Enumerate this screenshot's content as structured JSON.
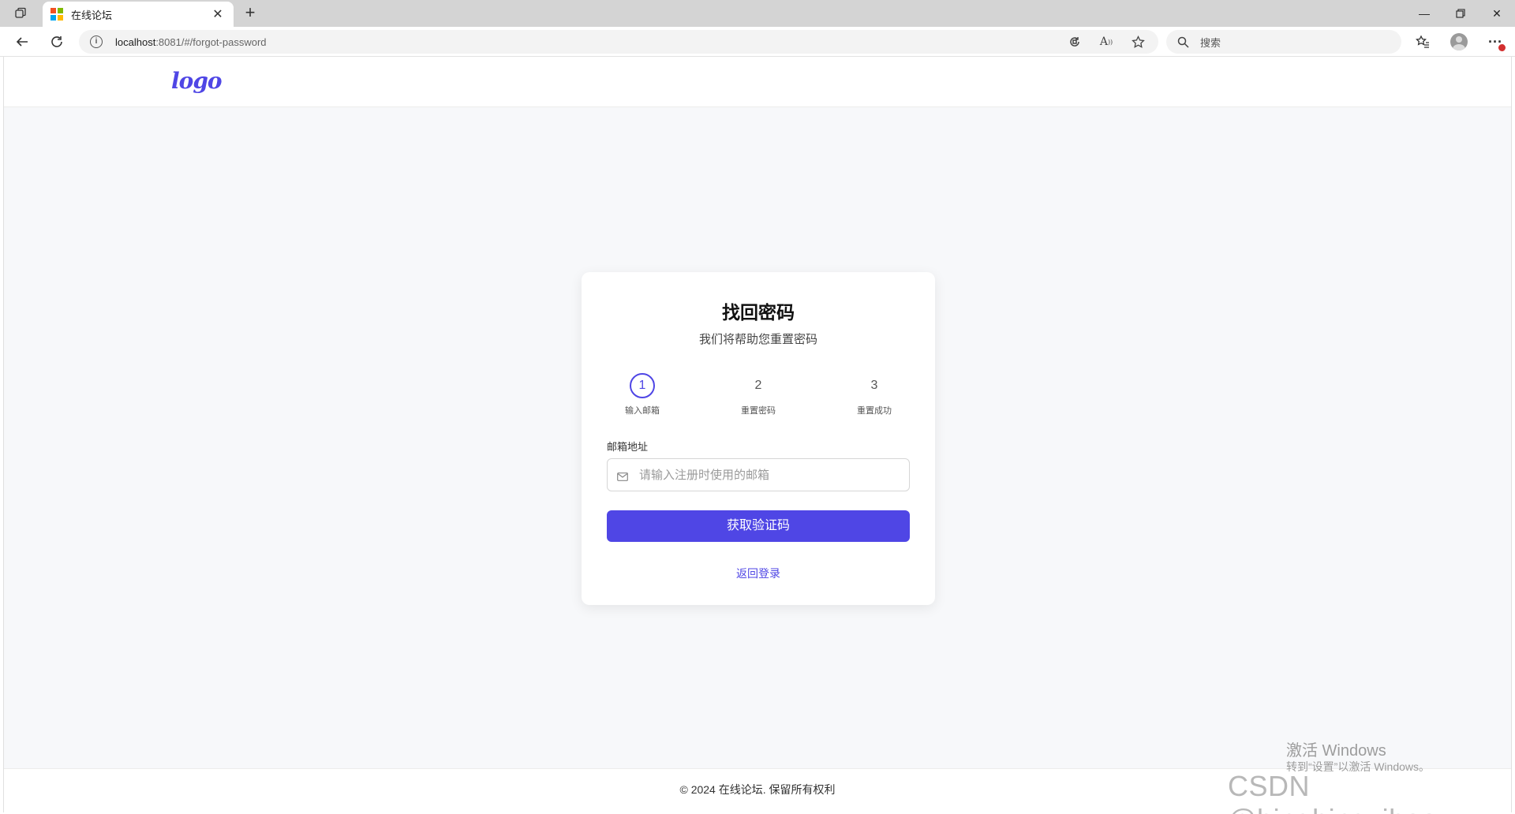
{
  "browser": {
    "tab": {
      "title": "在线论坛"
    },
    "address": {
      "host": "localhost",
      "rest": ":8081/#/forgot-password"
    },
    "search": {
      "placeholder": "搜索"
    }
  },
  "header": {
    "logo_text": "logo"
  },
  "card": {
    "title": "找回密码",
    "subtitle": "我们将帮助您重置密码",
    "steps": [
      {
        "num": "1",
        "label": "输入邮箱",
        "active": true
      },
      {
        "num": "2",
        "label": "重置密码",
        "active": false
      },
      {
        "num": "3",
        "label": "重置成功",
        "active": false
      }
    ],
    "email_label": "邮箱地址",
    "email_placeholder": "请输入注册时使用的邮箱",
    "email_value": "",
    "submit_label": "获取验证码",
    "back_link": "返回登录"
  },
  "footer": {
    "text": "© 2024 在线论坛. 保留所有权利"
  },
  "overlay": {
    "activate_title": "激活 Windows",
    "activate_sub": "转到“设置”以激活 Windows。",
    "csdn": "CSDN @bingbingyihao"
  },
  "colors": {
    "accent": "#4f46e5",
    "page_bg": "#f7f8fa"
  }
}
